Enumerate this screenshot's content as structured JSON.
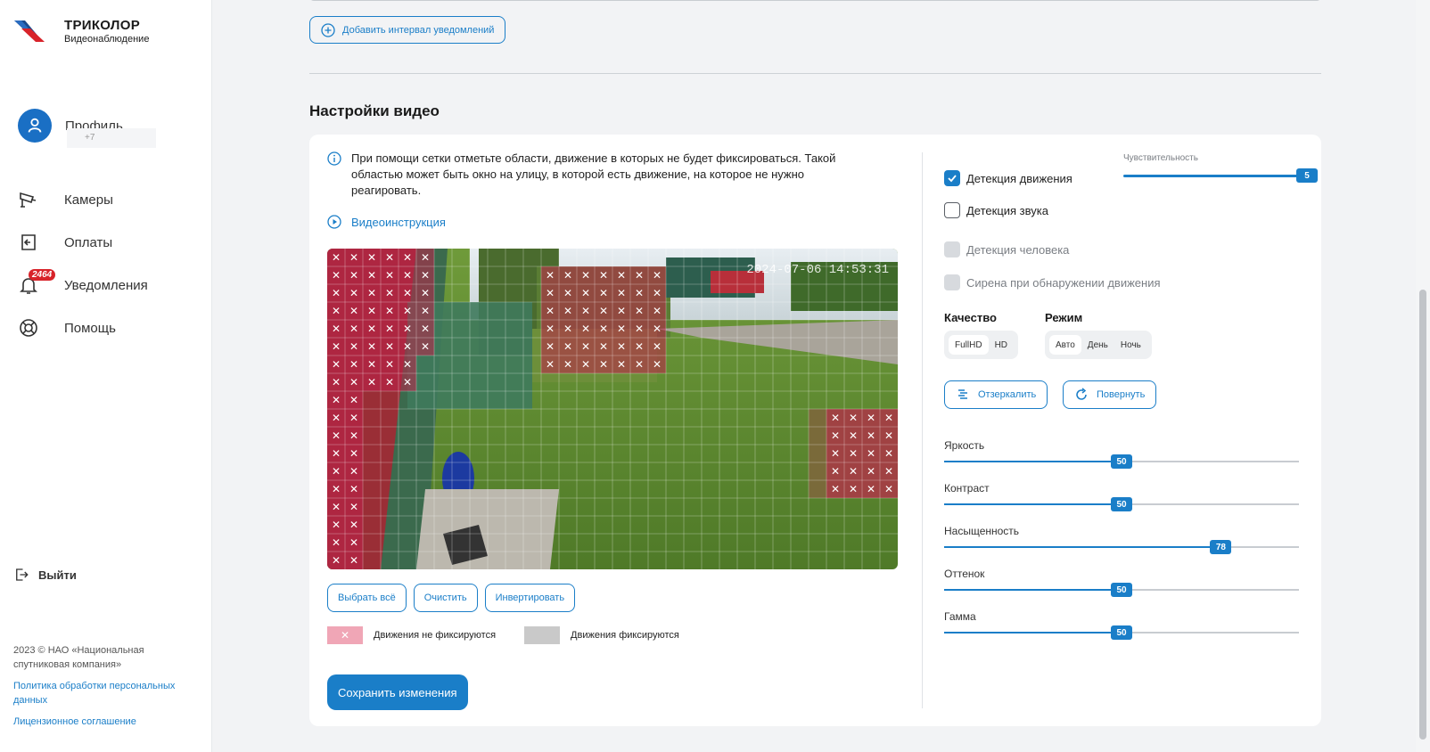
{
  "brand": {
    "title": "ТРИКОЛОР",
    "subtitle": "Видеонаблюдение"
  },
  "profile": {
    "name": "Профиль",
    "phone": "+7"
  },
  "nav": [
    {
      "label": "Камеры",
      "icon": "camera-icon"
    },
    {
      "label": "Оплаты",
      "icon": "payment-icon"
    },
    {
      "label": "Уведомления",
      "icon": "bell-icon",
      "badge": "2464"
    },
    {
      "label": "Помощь",
      "icon": "help-icon"
    }
  ],
  "logout": "Выйти",
  "footer": {
    "copyright": "2023 © НАО «Национальная спутниковая компания»",
    "privacy": "Политика обработки персональных данных",
    "license": "Лицензионное соглашение"
  },
  "notifications": {
    "add_interval": "Добавить интервал уведомлений"
  },
  "video_settings": {
    "title": "Настройки видео",
    "info": "При помощи сетки отметьте области, движение в которых не будет фиксироваться. Такой областью может быть окно на улицу, в которой есть движение, на которое не нужно реагировать.",
    "video_link": "Видеоинструкция",
    "timestamp": "2024-07-06 14:53:31",
    "grid_buttons": {
      "select_all": "Выбрать всё",
      "clear": "Очистить",
      "invert": "Инвертировать"
    },
    "legend": {
      "not_recorded": "Движения не фиксируются",
      "recorded": "Движения фиксируются"
    },
    "save": "Сохранить изменения"
  },
  "detection": {
    "motion": {
      "label": "Детекция движения",
      "checked": true
    },
    "sound": {
      "label": "Детекция звука",
      "checked": false
    },
    "human": {
      "label": "Детекция человека",
      "disabled": true
    },
    "siren": {
      "label": "Сирена при обнаружении движения",
      "disabled": true
    },
    "sensitivity": {
      "label": "Чувствительность",
      "value": 5,
      "max": 5
    }
  },
  "quality": {
    "title": "Качество",
    "options": [
      "FullHD",
      "HD"
    ],
    "selected": "FullHD"
  },
  "mode": {
    "title": "Режим",
    "options": [
      "Авто",
      "День",
      "Ночь"
    ],
    "selected": "Авто"
  },
  "actions": {
    "mirror": "Отзеркалить",
    "rotate": "Повернуть"
  },
  "image_sliders": [
    {
      "label": "Яркость",
      "value": 50
    },
    {
      "label": "Контраст",
      "value": 50
    },
    {
      "label": "Насыщенность",
      "value": 78
    },
    {
      "label": "Оттенок",
      "value": 50
    },
    {
      "label": "Гамма",
      "value": 50
    }
  ],
  "colors": {
    "accent": "#1a7ec8",
    "brand_red": "#d8232a",
    "mask": "#c0204a"
  }
}
